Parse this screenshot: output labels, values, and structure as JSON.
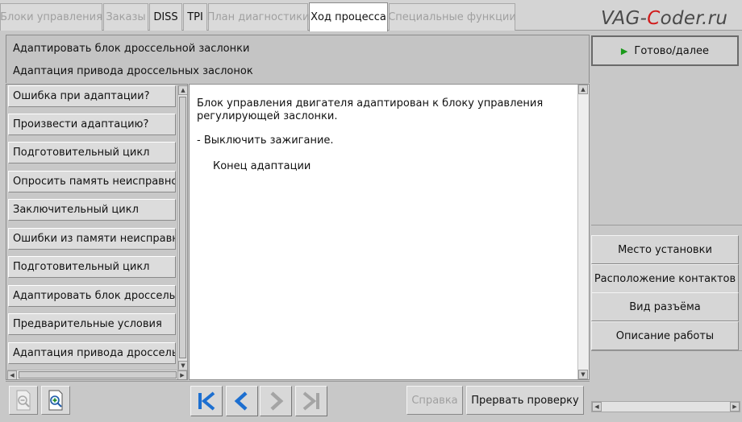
{
  "tabs": [
    {
      "label": "Блоки управления",
      "state": "disabled"
    },
    {
      "label": "Заказы",
      "state": "disabled"
    },
    {
      "label": "DISS",
      "state": "enabled"
    },
    {
      "label": "TPI",
      "state": "enabled"
    },
    {
      "label": "План диагностики",
      "state": "disabled"
    },
    {
      "label": "Ход процесса",
      "state": "active"
    },
    {
      "label": "Специальные функции",
      "state": "disabled"
    }
  ],
  "logo": {
    "part1": "VAG-",
    "part2": "C",
    "part3": "oder.ru",
    "accent_color": "#d11a1a"
  },
  "title": {
    "line1": "Адаптировать блок дроссельной заслонки",
    "line2": "Адаптация привода дроссельных заслонок"
  },
  "steps": [
    "Ошибка при адаптации?",
    "Произвести адаптацию?",
    "Подготовительный цикл",
    "Опросить память неисправностей",
    "Заключительный цикл",
    "Ошибки из памяти неисправностей",
    "Подготовительный цикл",
    "Адаптировать блок дроссельной заслонки",
    "Предварительные условия",
    "Адаптация привода дроссельных заслонок"
  ],
  "content": {
    "paragraph1": "Блок управления двигателя адаптирован к блоку управления регулирующей заслонки.",
    "paragraph2": "- Выключить зажигание.",
    "paragraph3": "Конец адаптации"
  },
  "toolbar": {
    "zoom_out_icon": "zoom-out-icon",
    "zoom_in_icon": "zoom-in-icon",
    "help_label": "Справка",
    "abort_label": "Прервать проверку"
  },
  "side": {
    "next_label": "Готово/далее",
    "buttons": [
      "Место установки",
      "Расположение контактов",
      "Вид разъёма",
      "Описание работы"
    ]
  }
}
